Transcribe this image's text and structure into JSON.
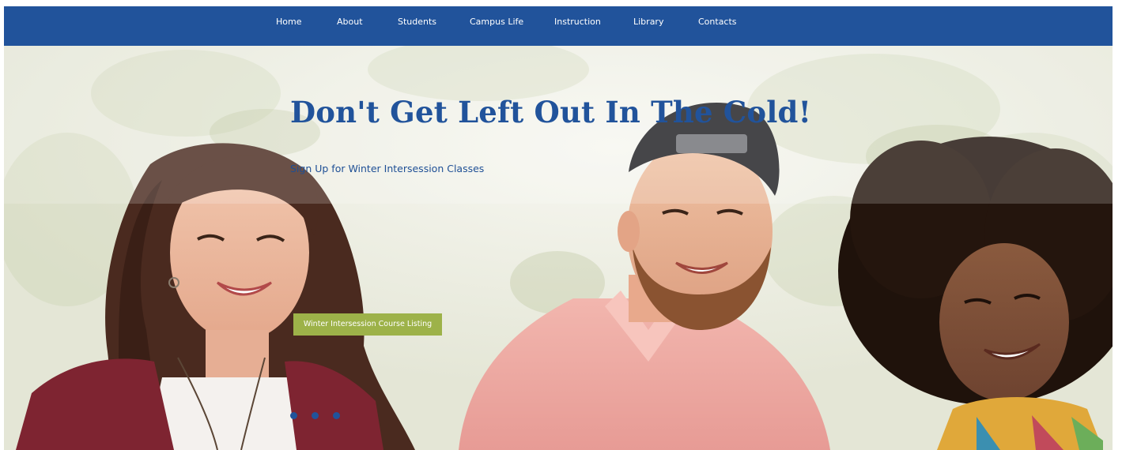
{
  "nav": {
    "items": [
      {
        "label": "Home"
      },
      {
        "label": "About"
      },
      {
        "label": "Students"
      },
      {
        "label": "Campus Life"
      },
      {
        "label": "Instruction"
      },
      {
        "label": "Library"
      },
      {
        "label": "Contacts"
      }
    ]
  },
  "hero": {
    "title": "Don't Get Left Out In The Cold!",
    "subtitle": "Sign Up for Winter Intersession Classes",
    "cta_label": "Winter Intersession Course Listing",
    "slide_count": 3
  },
  "colors": {
    "nav_background": "#21539b",
    "title_text": "#21539b",
    "cta_background": "#9db249",
    "dot": "#21539b"
  }
}
